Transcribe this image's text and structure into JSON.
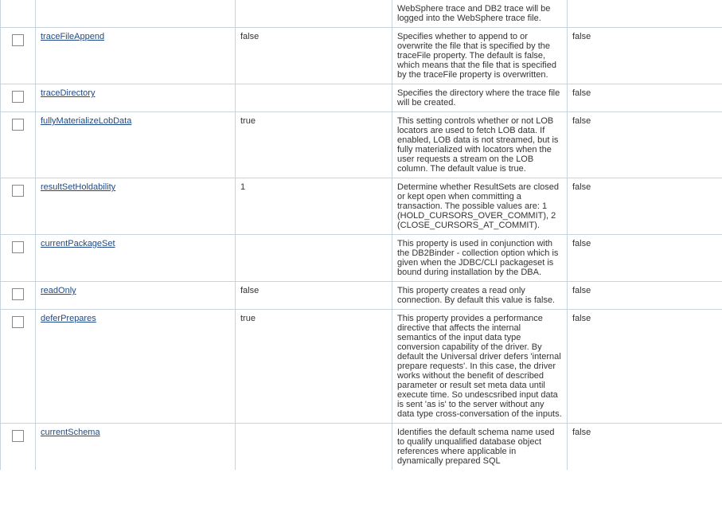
{
  "rows": [
    {
      "name_key": "",
      "value": "",
      "description": "WebSphere trace and DB2 trace will be logged into the WebSphere trace file.",
      "required": "",
      "check": false,
      "link": false,
      "partial_top": true
    },
    {
      "name_key": "traceFileAppend",
      "value": "false",
      "description": "Specifies whether to append to or overwrite the file that is specified by the traceFile property. The default is false, which means that the file that is specified by the traceFile property is overwritten.",
      "required": "false",
      "check": true,
      "link": true
    },
    {
      "name_key": "traceDirectory",
      "value": "",
      "description": "Specifies the directory where the trace file will be created.",
      "required": "false",
      "check": true,
      "link": true
    },
    {
      "name_key": "fullyMaterializeLobData",
      "value": "true",
      "description": "This setting controls whether or not LOB locators are used to fetch LOB data. If enabled, LOB data is not streamed, but is fully materialized with locators when the user requests a stream on the LOB column. The default value is true.",
      "required": "false",
      "check": true,
      "link": true
    },
    {
      "name_key": "resultSetHoldability",
      "value": "1",
      "description": "Determine whether ResultSets are closed or kept open when committing a transaction. The possible values are: 1 (HOLD_CURSORS_OVER_COMMIT), 2 (CLOSE_CURSORS_AT_COMMIT).",
      "required": "false",
      "check": true,
      "link": true
    },
    {
      "name_key": "currentPackageSet",
      "value": "",
      "description": "This property is used in conjunction with the DB2Binder - collection option which is given when the JDBC/CLI packageset is bound during installation by the DBA.",
      "required": "false",
      "check": true,
      "link": true
    },
    {
      "name_key": "readOnly",
      "value": "false",
      "description": "This property creates a read only connection. By default this value is false.",
      "required": "false",
      "check": true,
      "link": true
    },
    {
      "name_key": "deferPrepares",
      "value": "true",
      "description": "This property provides a performance directive that affects the internal semantics of the input data type conversion capability of the driver. By default the Universal driver defers 'internal prepare requests'. In this case, the driver works without the benefit of described parameter or result set meta data until execute time. So undescsribed input data is sent 'as is' to the server without any data type cross-conversation of the inputs.",
      "required": "false",
      "check": true,
      "link": true
    },
    {
      "name_key": "currentSchema",
      "value": "",
      "description": "Identifies the default schema name used to qualify unqualified database object references where applicable in dynamically prepared SQL",
      "required": "false",
      "check": true,
      "link": true,
      "partial_bottom": true
    }
  ]
}
